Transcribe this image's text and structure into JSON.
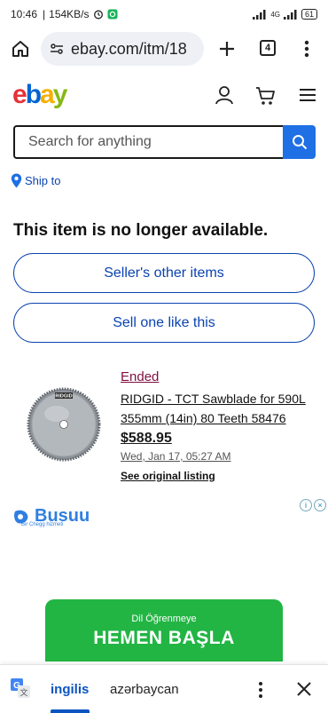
{
  "status_bar": {
    "time": "10:46",
    "speed": "154KB/s",
    "network": "4G",
    "battery": "61"
  },
  "browser": {
    "url": "ebay.com/itm/18",
    "tab_count": "4"
  },
  "ebay": {
    "logo_letters": [
      "e",
      "b",
      "a",
      "y"
    ],
    "logo_colors": [
      "#e53238",
      "#0064d2",
      "#f5af02",
      "#86b817"
    ],
    "search_placeholder": "Search for anything",
    "ship_to": "Ship to",
    "unavailable_message": "This item is no longer available.",
    "sellers_other_items": "Seller's other items",
    "sell_one_like_this": "Sell one like this",
    "listing": {
      "status": "Ended",
      "title": "RIDGID - TCT Sawblade for 590L 355mm (14in) 80 Teeth 58476",
      "price": "$588.95",
      "date": "Wed, Jan 17, 05:27 AM",
      "original_listing_link": "See original listing",
      "image_brand": "RIDGID"
    }
  },
  "ad": {
    "brand": "Busuu",
    "tagline": "Bir Chegg hizmeti",
    "cta_sub": "Dil Öğrenmeye",
    "cta_main": "HEMEN BAŞLA"
  },
  "translate_bar": {
    "source_lang": "ingilis",
    "target_lang": "azərbaycan"
  },
  "colors": {
    "accent_blue": "#0a43b0",
    "search_button": "#1f6fe5",
    "ended_red": "#7f0f3f",
    "cta_green": "#22b544"
  }
}
